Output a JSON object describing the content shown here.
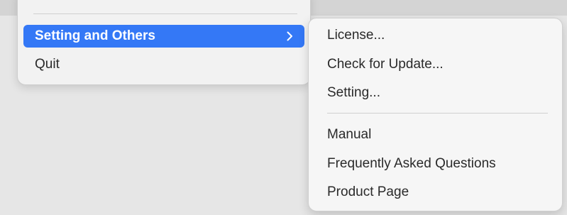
{
  "main_menu": {
    "items": [
      {
        "label": "Setting and Others",
        "highlighted": true,
        "has_submenu": true,
        "chevron": "chevron-right-icon"
      },
      {
        "label": "Quit",
        "highlighted": false
      }
    ]
  },
  "submenu": {
    "groups": [
      [
        "License...",
        "Check for Update...",
        "Setting..."
      ],
      [
        "Manual",
        "Frequently Asked Questions",
        "Product Page"
      ]
    ]
  },
  "colors": {
    "highlight": "#3478f6",
    "menu_text": "#2a2a2a",
    "menu_background": "#f2f2f2",
    "submenu_background": "#f6f6f6"
  }
}
